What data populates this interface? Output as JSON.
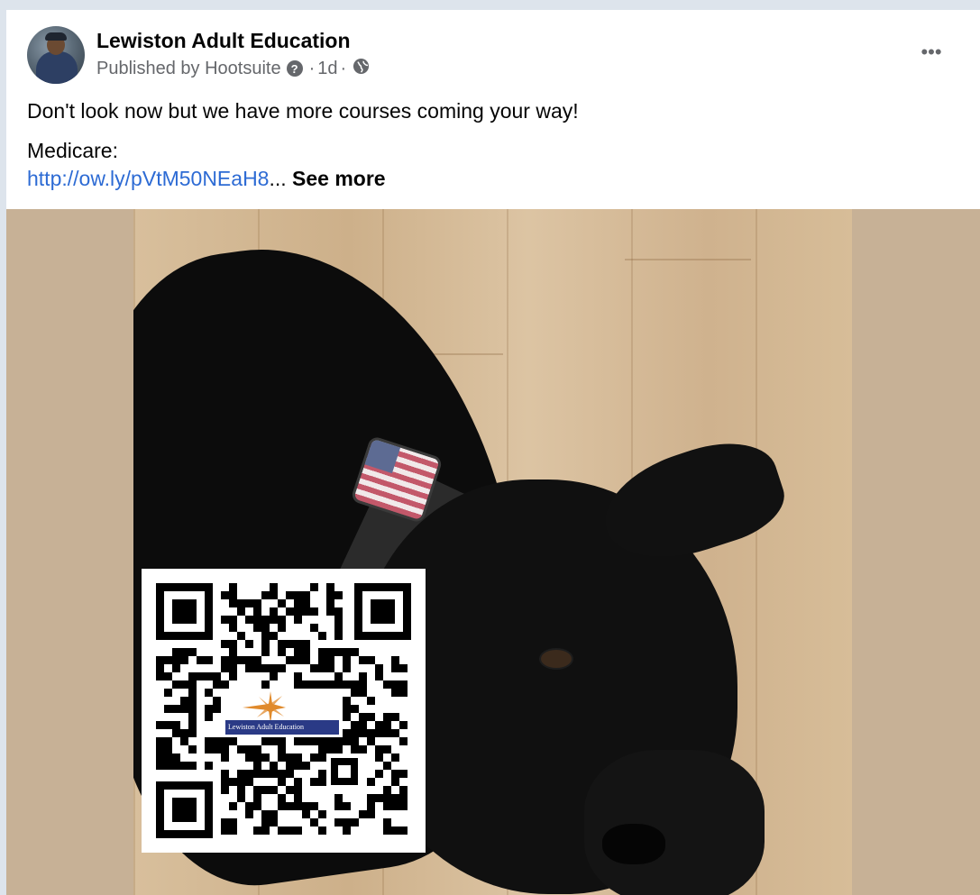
{
  "post": {
    "page_name": "Lewiston Adult Education",
    "published_by": "Published by Hootsuite",
    "time": "1d",
    "separator": "·",
    "text_line1": "Don't look now but we have more courses coming your way!",
    "text_line2": "Medicare:",
    "link": "http://ow.ly/pVtM50NEaH8",
    "ellipsis": "...",
    "see_more": "See more",
    "more_options": "•••"
  },
  "qr_code": {
    "logo_text": "Lewiston Adult Education"
  },
  "icons": {
    "help": "help-question-icon",
    "audience": "globe-icon",
    "more": "more-horizontal-icon"
  },
  "colors": {
    "link": "#2d6bd4",
    "text": "#050505",
    "secondary": "#65676b",
    "media_background": "#c7b196",
    "qr_banner": "#2a3a86",
    "qr_sunburst": "#e08a2c"
  }
}
